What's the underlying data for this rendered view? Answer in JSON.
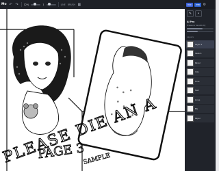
{
  "app": {
    "brand": "Mo"
  },
  "toolbar": {
    "zoom_value": "12%",
    "size_value": "1",
    "mode_text": "LINE",
    "label_text": "BRUSH",
    "btn_fire": "FIRE",
    "btn_fill": "FILL"
  },
  "sidebar": {
    "tab_1": "PAR",
    "tab_2": "PHB",
    "title": "Ai Pen",
    "subtitle": "Pressure Sensitivity",
    "section": "Layers",
    "layers": [
      {
        "label": "Layer 1"
      },
      {
        "label": "Sketch"
      },
      {
        "label": "Panel"
      },
      {
        "label": "Inks"
      },
      {
        "label": "Tone"
      },
      {
        "label": "Text"
      },
      {
        "label": "Lines"
      },
      {
        "label": "BG"
      },
      {
        "label": "Paper"
      }
    ]
  },
  "watermark": {
    "line1": "PLEASE DIE AN A",
    "line2": "PAGE 3",
    "line3": "SAMPLE"
  },
  "colors": {
    "accent": "#3d63d8",
    "panel_bg": "#20232a",
    "toolbar_bg": "#1e2127"
  },
  "icons": [
    "undo-icon",
    "redo-icon",
    "grid-icon",
    "pen-icon",
    "settings-icon"
  ]
}
